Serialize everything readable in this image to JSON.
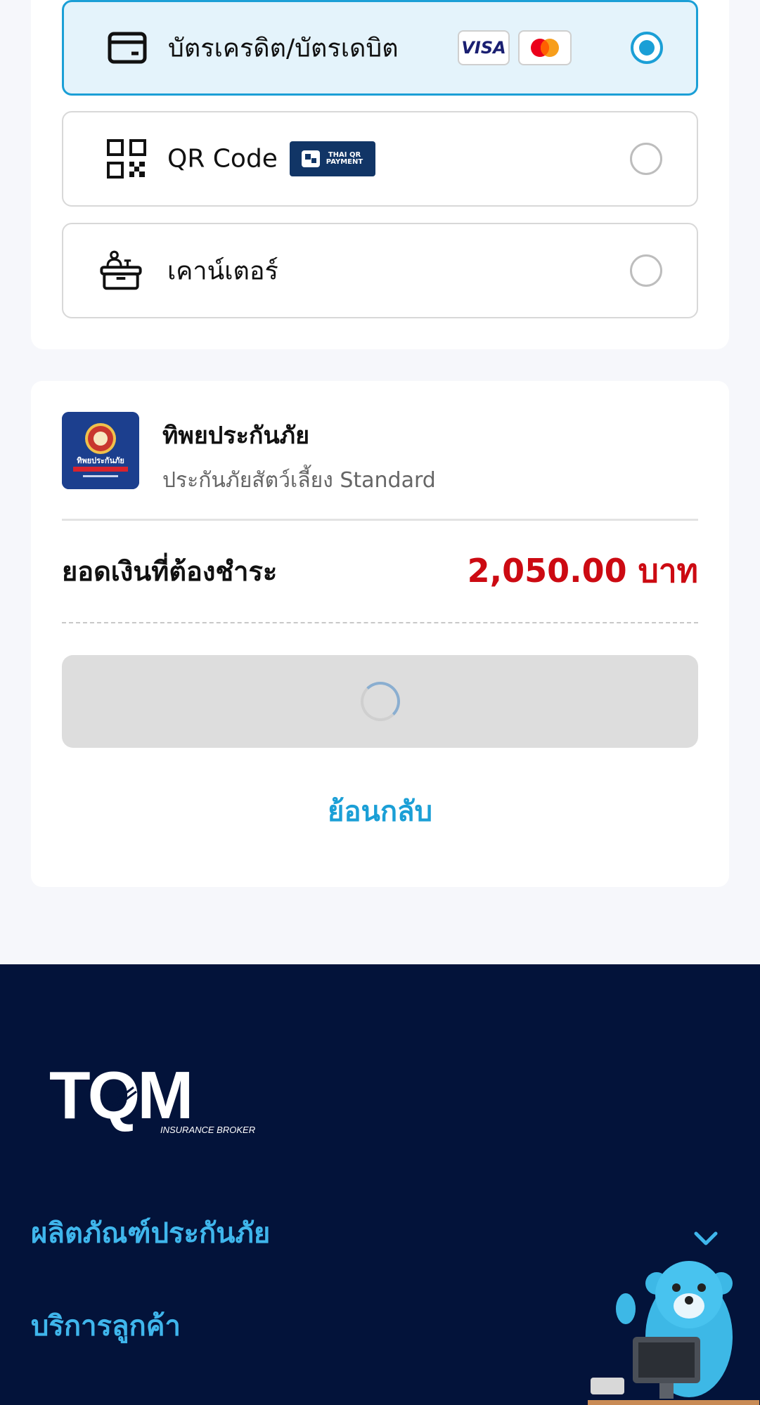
{
  "payment_methods": [
    {
      "label": "บัตรเครดิต/บัตรเดบิต",
      "icon": "credit-card-icon",
      "selected": true,
      "badges": [
        "VISA",
        "mastercard-icon"
      ]
    },
    {
      "label": "QR Code",
      "icon": "qr-code-icon",
      "selected": false,
      "badges": [
        "THAI QR PAYMENT"
      ]
    },
    {
      "label": "เคาน์เตอร์",
      "icon": "counter-icon",
      "selected": false,
      "badges": []
    }
  ],
  "summary": {
    "insurer_name": "ทิพยประกันภัย",
    "plan_name": "ประกันภัยสัตว์เลี้ยง Standard",
    "logo_text": "ทิพยประกันภัย",
    "amount_label": "ยอดเงินที่ต้องชำระ",
    "amount_value": "2,050.00 บาท",
    "pay_button_state": "loading",
    "back_label": "ย้อนกลับ"
  },
  "footer": {
    "logo_text": "TQM",
    "logo_subtext": "INSURANCE BROKER",
    "items": [
      {
        "label": "ผลิตภัณฑ์ประกันภัย",
        "expandable": true
      },
      {
        "label": "บริการลูกค้า",
        "expandable": false
      }
    ]
  },
  "colors": {
    "accent": "#1b9fd6",
    "amount": "#cc0a12",
    "footer_bg": "#03133a",
    "footer_link": "#3fb6ec"
  }
}
